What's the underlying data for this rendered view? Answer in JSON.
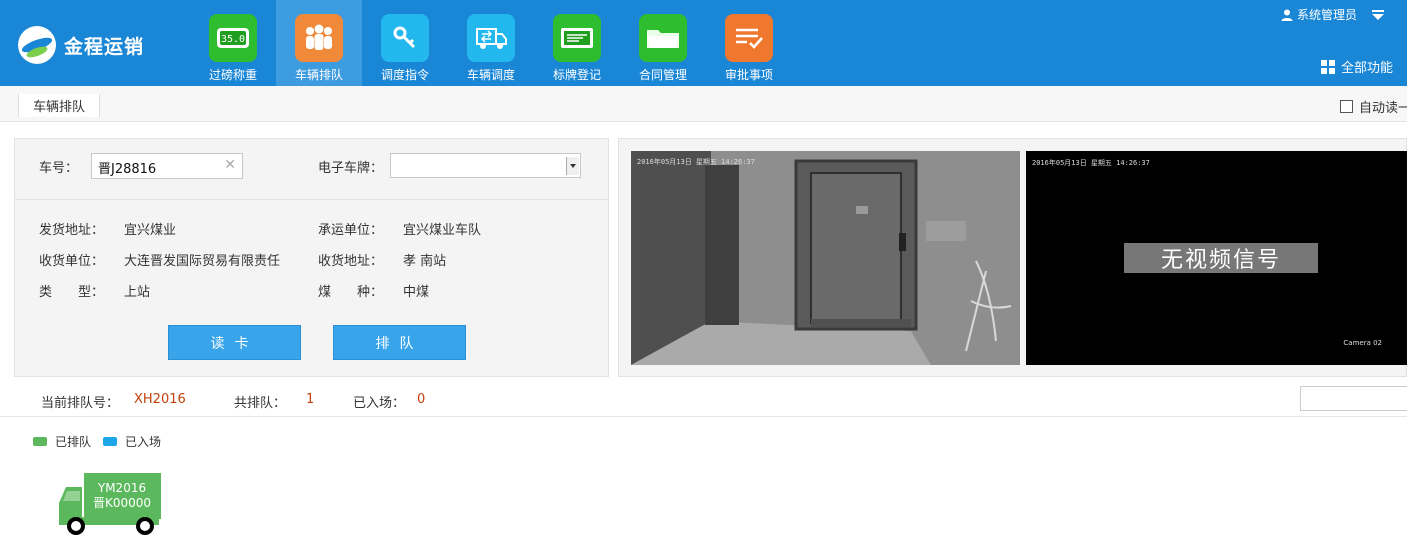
{
  "app": {
    "title": "金程运销"
  },
  "header": {
    "user_name": "系统管理员",
    "all_functions": "全部功能",
    "nav": [
      {
        "label": "过磅称重",
        "icon": "scale-display-icon",
        "color": "#2ebd2e",
        "active": false,
        "glyph": "35.0"
      },
      {
        "label": "车辆排队",
        "icon": "people-queue-icon",
        "color": "#f08a3a",
        "active": true
      },
      {
        "label": "调度指令",
        "icon": "key-icon",
        "color": "#22b8ee",
        "active": false
      },
      {
        "label": "车辆调度",
        "icon": "truck-dispatch-icon",
        "color": "#22b8ee",
        "active": false
      },
      {
        "label": "标牌登记",
        "icon": "license-plate-icon",
        "color": "#2ebd2e",
        "active": false
      },
      {
        "label": "合同管理",
        "icon": "folder-icon",
        "color": "#2ebd2e",
        "active": false
      },
      {
        "label": "审批事项",
        "icon": "checklist-icon",
        "color": "#f0772e",
        "active": false
      }
    ]
  },
  "breadcrumb": {
    "label": "车辆排队"
  },
  "auto_read": {
    "label": "自动读一"
  },
  "form": {
    "car_no_label": "车号：",
    "car_no_value": "晋J28816",
    "e_plate_label": "电子车牌：",
    "e_plate_value": "",
    "fields": [
      {
        "label": "发货地址：",
        "value": "宜兴煤业"
      },
      {
        "label": "承运单位：",
        "value": "宜兴煤业车队"
      },
      {
        "label": "收货单位：",
        "value": "大连晋发国际贸易有限责任"
      },
      {
        "label": "收货地址：",
        "value": "孝 南站"
      },
      {
        "label": "类　　型：",
        "value": "上站"
      },
      {
        "label": "煤　　种：",
        "value": "中煤"
      }
    ],
    "read_card_btn": "读卡",
    "queue_btn": "排队"
  },
  "video": {
    "cam1_timestamp": "2016年05月13日 星期五 14:26:37",
    "cam2_timestamp": "2016年05月13日 星期五 14:26:37",
    "no_signal": "无视频信号",
    "cam2_name": "Camera 02"
  },
  "status": {
    "current_label": "当前排队号：",
    "current_value": "XH2016",
    "total_label": "共排队：",
    "total_value": "1",
    "entered_label": "已入场：",
    "entered_value": "0"
  },
  "legend": [
    {
      "label": "已排队",
      "color": "#5cb85c"
    },
    {
      "label": "已入场",
      "color": "#1ea7e8"
    }
  ],
  "trucks": [
    {
      "code": "YM2016",
      "plate": "晋K00000",
      "color": "#5cb85c"
    }
  ]
}
